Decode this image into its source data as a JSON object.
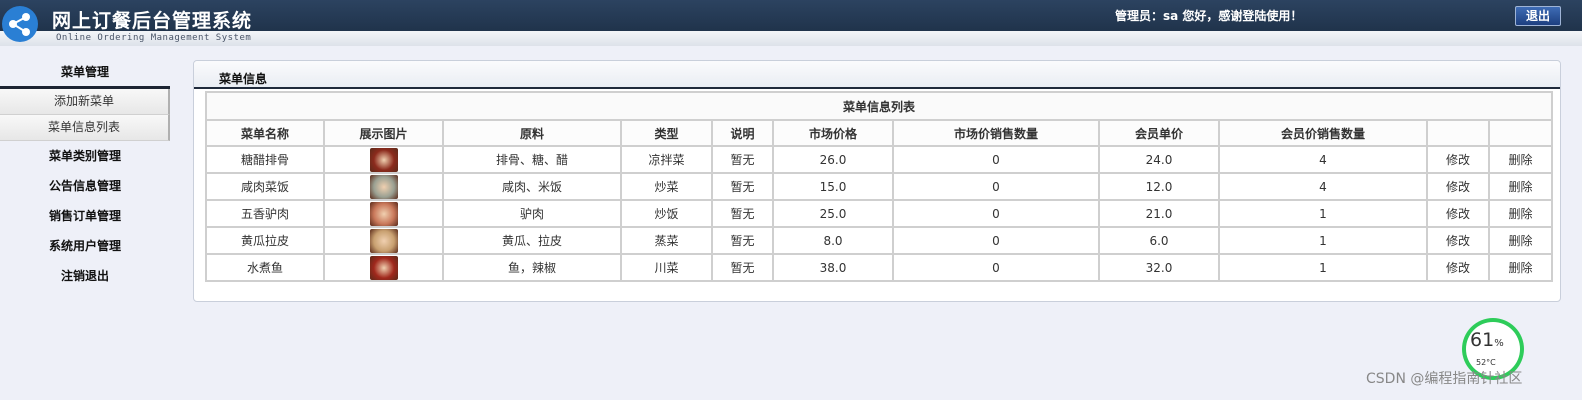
{
  "header": {
    "title": "网上订餐后台管理系统",
    "subtitle": "Online Ordering Management System",
    "welcome": "管理员：sa 您好，感谢登陆使用！",
    "logout_label": "退出"
  },
  "sidebar": {
    "section_title": "菜单管理",
    "sub_items": [
      "添加新菜单",
      "菜单信息列表"
    ],
    "groups": [
      "菜单类别管理",
      "公告信息管理",
      "销售订单管理",
      "系统用户管理",
      "注销退出"
    ]
  },
  "panel": {
    "title": "菜单信息",
    "table_caption": "菜单信息列表",
    "columns": [
      "菜单名称",
      "展示图片",
      "原料",
      "类型",
      "说明",
      "市场价格",
      "市场价销售数量",
      "会员单价",
      "会员价销售数量",
      "",
      ""
    ],
    "rows": [
      {
        "name": "糖醋排骨",
        "ingredients": "排骨、糖、醋",
        "type": "凉拌菜",
        "desc": "暂无",
        "market_price": "26.0",
        "market_sales": "0",
        "member_price": "24.0",
        "member_sales": "4",
        "edit": "修改",
        "delete": "删除",
        "thumb_color": "#8b2a1c"
      },
      {
        "name": "咸肉菜饭",
        "ingredients": "咸肉、米饭",
        "type": "炒菜",
        "desc": "暂无",
        "market_price": "15.0",
        "market_sales": "0",
        "member_price": "12.0",
        "member_sales": "4",
        "edit": "修改",
        "delete": "删除",
        "thumb_color": "#9aa092"
      },
      {
        "name": "五香驴肉",
        "ingredients": "驴肉",
        "type": "炒饭",
        "desc": "暂无",
        "market_price": "25.0",
        "market_sales": "0",
        "member_price": "21.0",
        "member_sales": "1",
        "edit": "修改",
        "delete": "删除",
        "thumb_color": "#c9785a"
      },
      {
        "name": "黄瓜拉皮",
        "ingredients": "黄瓜、拉皮",
        "type": "蒸菜",
        "desc": "暂无",
        "market_price": "8.0",
        "market_sales": "0",
        "member_price": "6.0",
        "member_sales": "1",
        "edit": "修改",
        "delete": "删除",
        "thumb_color": "#c8a070"
      },
      {
        "name": "水煮鱼",
        "ingredients": "鱼，辣椒",
        "type": "川菜",
        "desc": "暂无",
        "market_price": "38.0",
        "market_sales": "0",
        "member_price": "32.0",
        "member_sales": "1",
        "edit": "修改",
        "delete": "删除",
        "thumb_color": "#a0281c"
      }
    ]
  },
  "widget": {
    "percent": "61",
    "percent_unit": "%",
    "temp": "52°C"
  },
  "watermark": "CSDN @编程指南针社区"
}
